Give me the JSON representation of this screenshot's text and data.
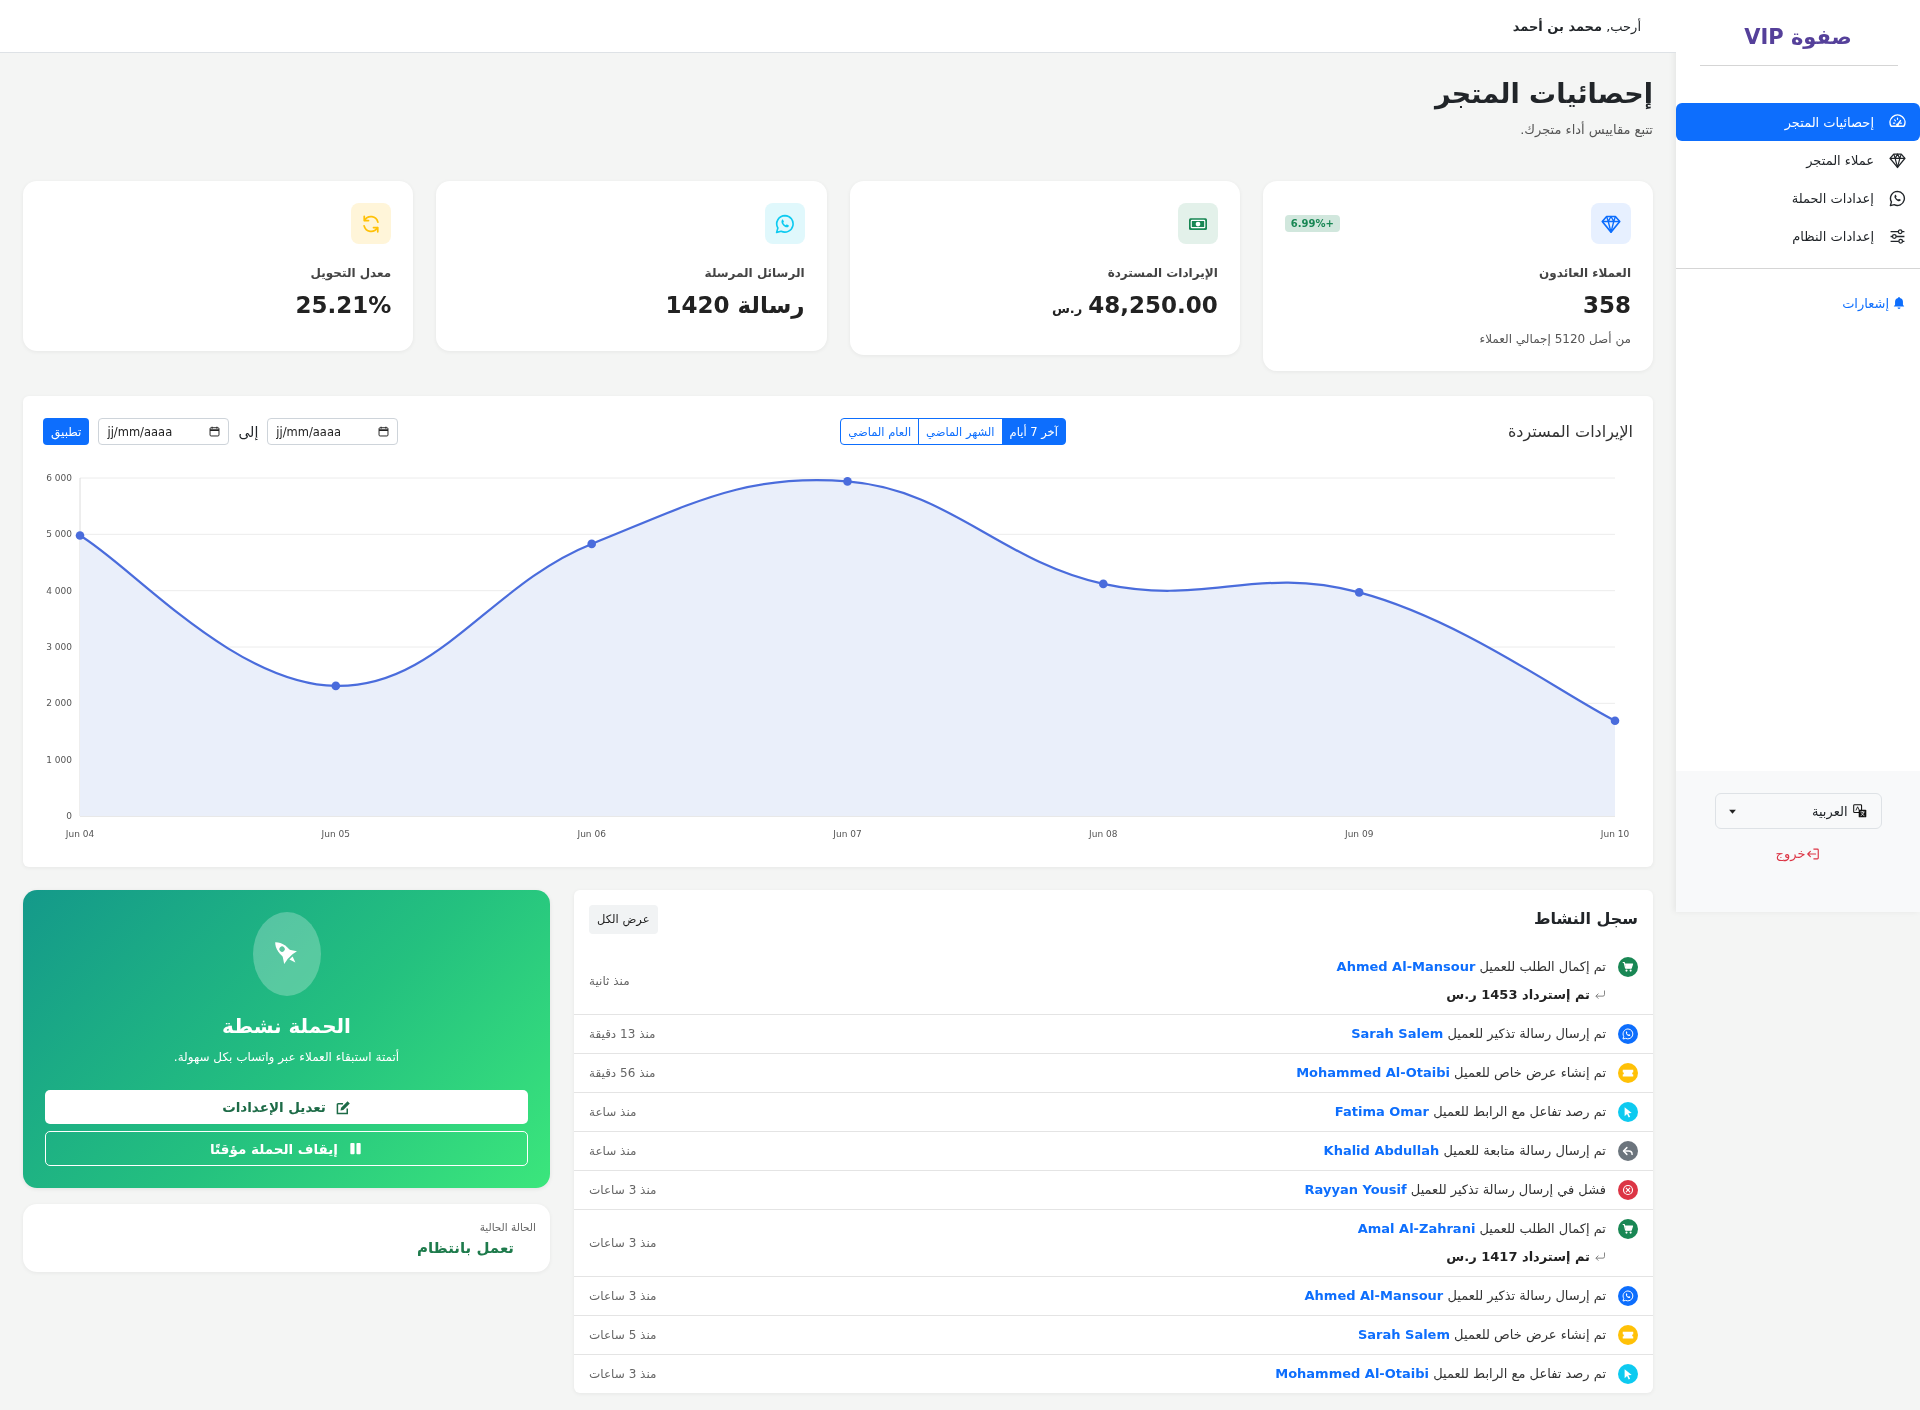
{
  "header": {
    "welcome": "أرحب, **محمد بن أحمد**"
  },
  "sidebar": {
    "brand": "صفوة VIP",
    "nav": [
      {
        "kind": "dashboard",
        "label": "إحصائيات المتجر",
        "selected": true
      },
      {
        "kind": "customers",
        "label": "عملاء المتجر",
        "selected": false
      },
      {
        "kind": "campaign",
        "label": "إعدادات الحملة",
        "selected": false
      },
      {
        "kind": "system",
        "label": "إعدادات النظام",
        "selected": false
      }
    ],
    "notifications": "إشعارات",
    "language": "العربية",
    "logout": "خروج"
  },
  "page": {
    "title": "إحصائيات المتجر",
    "subtitle": "تتبع مقاييس أداء متجرك."
  },
  "stats": [
    {
      "kind": "customers",
      "label": "العملاء العائدون",
      "value": "358",
      "badge": "+6.99%",
      "note": "من أصل 5120 إجمالي العملاء"
    },
    {
      "kind": "revenue",
      "label": "الإيرادات المستردة",
      "value": "48,250.00",
      "unit": "ر.س"
    },
    {
      "kind": "messages",
      "label": "الرسائل المرسلة",
      "value": "1420 رسالة"
    },
    {
      "kind": "conversion",
      "label": "معدل التحويل",
      "value": "25.21%"
    }
  ],
  "revenue_chart": {
    "ranges": [
      {
        "label": "آخر 7 أيام",
        "selected": true
      },
      {
        "label": "الشهر الماضي",
        "selected": false
      },
      {
        "label": "العام الماضي",
        "selected": false
      }
    ],
    "date_from": {
      "placeholder": "jj/mm/aaaa"
    },
    "separator": "إلى",
    "date_to": {
      "placeholder": "jj/mm/aaaa"
    },
    "apply": "تطبيق",
    "chart_data": {
      "type": "area",
      "title": "الإيرادات المستردة",
      "grid": true,
      "categories": [
        "Jun 04",
        "Jun 05",
        "Jun 06",
        "Jun 07",
        "Jun 08",
        "Jun 09",
        "Jun 10"
      ],
      "values": [
        4980,
        2310,
        4830,
        5940,
        4120,
        3970,
        1690
      ],
      "ylim": [
        0,
        6000
      ],
      "yticks": [
        0,
        {
          "value": 1000,
          "label": "1 000"
        },
        {
          "value": 2000,
          "label": "2 000"
        },
        {
          "value": 3000,
          "label": "3 000"
        },
        {
          "value": 4000,
          "label": "4 000"
        },
        {
          "value": 5000,
          "label": "5 000"
        },
        {
          "value": 6000,
          "label": "6 000"
        }
      ]
    }
  },
  "campaign": {
    "title": "الحملة نشطة",
    "description": "أتمتة استبقاء العملاء عبر واتساب بكل سهولة.",
    "buttons": [
      {
        "kind": "edit",
        "label": "تعديل الإعدادات"
      },
      {
        "kind": "pause",
        "label": "إيقاف الحملة مؤقتًا"
      }
    ]
  },
  "status": {
    "label": "الحالة الحالية",
    "value": "تعمل بانتظام"
  },
  "activity": {
    "title": "سجل النشاط",
    "view_all": "عرض الكل",
    "items": [
      {
        "kind": "order",
        "action": "تم إكمال الطلب للعميل",
        "customer": "Ahmed Al-Mansour",
        "recovered": "تم إسترداد 1453 ر.س",
        "time": "منذ ثانية"
      },
      {
        "kind": "reminder",
        "action": "تم إرسال رسالة تذكير للعميل",
        "customer": "Sarah Salem",
        "time": "منذ 13 دقيقة"
      },
      {
        "kind": "offer",
        "action": "تم إنشاء عرض خاص للعميل",
        "customer": "Mohammed Al-Otaibi",
        "time": "منذ 56 دقيقة"
      },
      {
        "kind": "click",
        "action": "تم رصد تفاعل مع الرابط للعميل",
        "customer": "Fatima Omar",
        "time": "منذ ساعة"
      },
      {
        "kind": "followup",
        "action": "تم إرسال رسالة متابعة للعميل",
        "customer": "Khalid Abdullah",
        "time": "منذ ساعة"
      },
      {
        "kind": "failed",
        "action": "فشل في إرسال رسالة تذكير للعميل",
        "customer": "Rayyan Yousif",
        "time": "منذ 3 ساعات"
      },
      {
        "kind": "order",
        "action": "تم إكمال الطلب للعميل",
        "customer": "Amal Al-Zahrani",
        "recovered": "تم إسترداد 1417 ر.س",
        "time": "منذ 3 ساعات"
      },
      {
        "kind": "reminder",
        "action": "تم إرسال رسالة تذكير للعميل",
        "customer": "Ahmed Al-Mansour",
        "time": "منذ 3 ساعات"
      },
      {
        "kind": "offer",
        "action": "تم إنشاء عرض خاص للعميل",
        "customer": "Sarah Salem",
        "time": "منذ 5 ساعات"
      },
      {
        "kind": "click",
        "action": "تم رصد تفاعل مع الرابط للعميل",
        "customer": "Mohammed Al-Otaibi",
        "time": "منذ 3 ساعات"
      }
    ]
  }
}
